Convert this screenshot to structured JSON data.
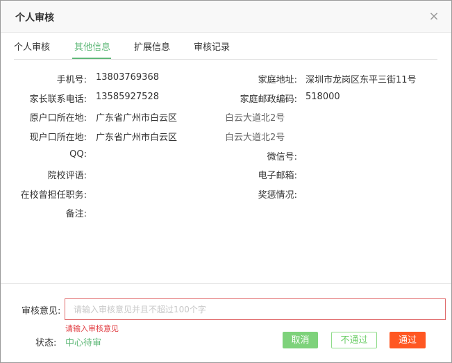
{
  "dialog": {
    "title": "个人审核",
    "close_glyph": "×"
  },
  "tabs": [
    {
      "label": "个人审核",
      "active": false
    },
    {
      "label": "其他信息",
      "active": true
    },
    {
      "label": "扩展信息",
      "active": false
    },
    {
      "label": "审核记录",
      "active": false
    }
  ],
  "info": {
    "phone": {
      "label": "手机号:",
      "value": "13803769368"
    },
    "home_address": {
      "label": "家庭地址:",
      "value": "深圳市龙岗区东平三街11号"
    },
    "parent_phone": {
      "label": "家长联系电话:",
      "value": "13585927528"
    },
    "home_postcode": {
      "label": "家庭邮政编码:",
      "value": "518000"
    },
    "origin_hukou": {
      "label": "原户口所在地:",
      "value": "广东省广州市白云区",
      "detail": "白云大道北2号"
    },
    "current_hukou": {
      "label": "现户口所在地:",
      "value": "广东省广州市白云区",
      "detail": "白云大道北2号"
    },
    "qq": {
      "label": "QQ:",
      "value": ""
    },
    "wechat": {
      "label": "微信号:",
      "value": ""
    },
    "school_comment": {
      "label": "院校评语:",
      "value": ""
    },
    "email": {
      "label": "电子邮箱:",
      "value": ""
    },
    "school_position": {
      "label": "在校曾担任职务:",
      "value": ""
    },
    "awards": {
      "label": "奖惩情况:",
      "value": ""
    },
    "remark": {
      "label": "备注:",
      "value": ""
    }
  },
  "footer": {
    "opinion_label": "审核意见:",
    "opinion_placeholder": "请输入审核意见并且不超过100个字",
    "opinion_value": "",
    "error_text": "请输入审核意见",
    "status_label": "状态:",
    "status_value": "中心待审",
    "cancel_label": "取消",
    "reject_label": "不通过",
    "pass_label": "通过"
  },
  "colors": {
    "accent_green": "#5fb878",
    "error_red": "#e0393e",
    "pass_orange": "#ff5722"
  }
}
